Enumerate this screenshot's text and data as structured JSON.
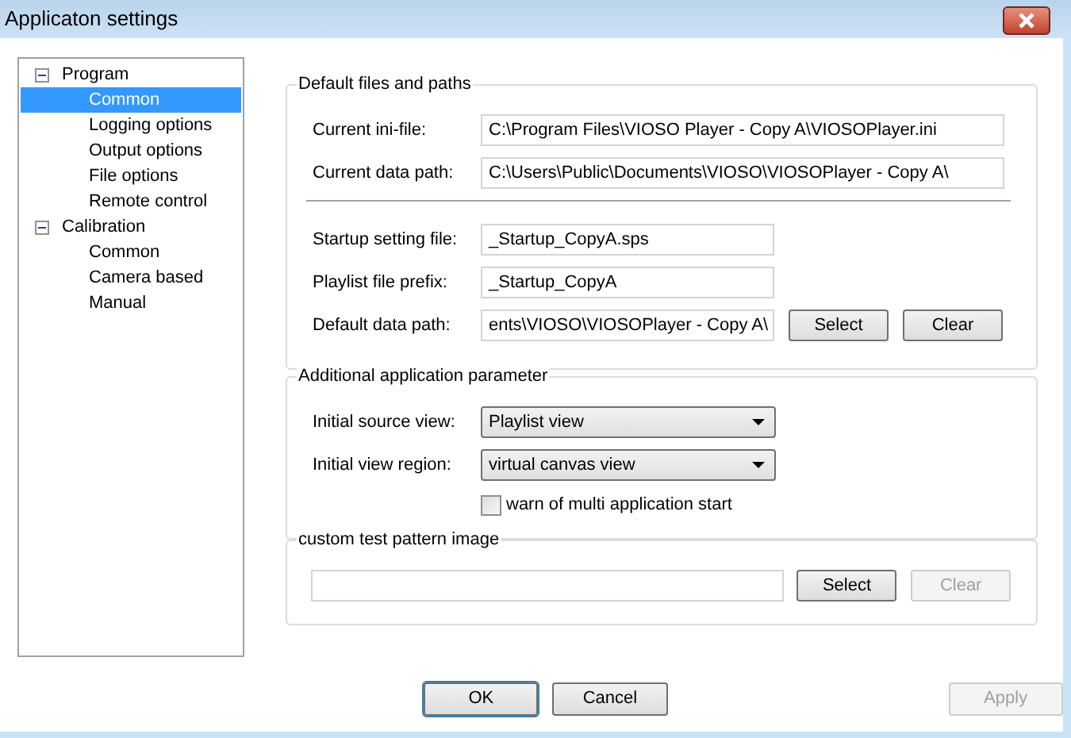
{
  "window": {
    "title": "Applicaton settings"
  },
  "tree": [
    {
      "label": "Program",
      "expanded": true,
      "selected": false,
      "children": [
        {
          "label": "Common",
          "selected": true
        },
        {
          "label": "Logging options",
          "selected": false
        },
        {
          "label": "Output options",
          "selected": false
        },
        {
          "label": "File options",
          "selected": false
        },
        {
          "label": "Remote control",
          "selected": false
        }
      ]
    },
    {
      "label": "Calibration",
      "expanded": true,
      "selected": false,
      "children": [
        {
          "label": "Common",
          "selected": false
        },
        {
          "label": "Camera based",
          "selected": false
        },
        {
          "label": "Manual",
          "selected": false
        }
      ]
    }
  ],
  "sections": [
    {
      "title": "Default files and paths",
      "rows": [
        {
          "kind": "path",
          "label": "Current ini-file:",
          "value": "C:\\Program Files\\VIOSO Player - Copy A\\VIOSOPlayer.ini"
        },
        {
          "kind": "path",
          "label": "Current data path:",
          "value": "C:\\Users\\Public\\Documents\\VIOSO\\VIOSOPlayer - Copy A\\"
        },
        {
          "kind": "separator"
        },
        {
          "kind": "field",
          "label": "Startup setting file:",
          "value": "_Startup_CopyA.sps"
        },
        {
          "kind": "field",
          "label": "Playlist file prefix:",
          "value": "_Startup_CopyA"
        },
        {
          "kind": "field",
          "label": "Default data path:",
          "value": "ents\\VIOSO\\VIOSOPlayer - Copy A\\",
          "buttons": [
            {
              "label": "Select",
              "disabled": false
            },
            {
              "label": "Clear",
              "disabled": false
            }
          ]
        }
      ]
    },
    {
      "title": "Additional application parameter",
      "rows": [
        {
          "kind": "combo",
          "label": "Initial source view:",
          "value": "Playlist view"
        },
        {
          "kind": "combo",
          "label": "Initial view region:",
          "value": "virtual canvas view"
        },
        {
          "kind": "checkbox",
          "label": "warn of multi application start",
          "checked": false
        }
      ]
    },
    {
      "title": "custom test pattern image",
      "rows": [
        {
          "kind": "wide-field",
          "buttons": [
            {
              "label": "Select",
              "disabled": false
            },
            {
              "label": "Clear",
              "disabled": true
            }
          ]
        }
      ]
    }
  ],
  "buttons": [
    {
      "label": "OK",
      "disabled": false,
      "default": true
    },
    {
      "label": "Cancel",
      "disabled": false,
      "default": false
    },
    {
      "label": "Apply",
      "disabled": true,
      "default": false
    }
  ]
}
